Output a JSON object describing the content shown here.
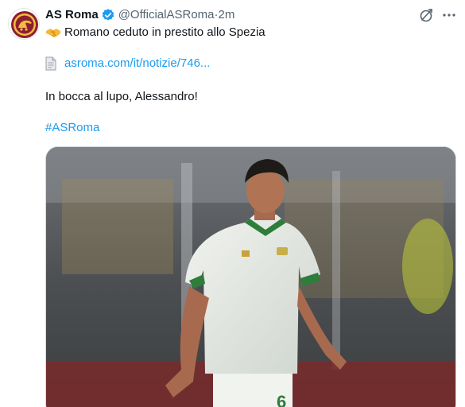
{
  "tweet": {
    "display_name": "AS Roma",
    "handle": "@OfficialASRoma",
    "separator": " · ",
    "time": "2m",
    "line1": "Romano ceduto in prestito allo Spezia",
    "link_text": "asroma.com/it/notizie/746...",
    "line3": "In bocca al lupo, Alessandro!",
    "hashtag": "#ASRoma",
    "image_alt": "Player in white and green Spezia kit, number 6"
  },
  "colors": {
    "link": "#1d9bf0",
    "verified": "#1d9bf0",
    "secondary_text": "#536471"
  },
  "icons": [
    "as-roma-logo",
    "verified-badge-icon",
    "grok-icon",
    "more-icon",
    "handshake-icon",
    "page-icon"
  ]
}
